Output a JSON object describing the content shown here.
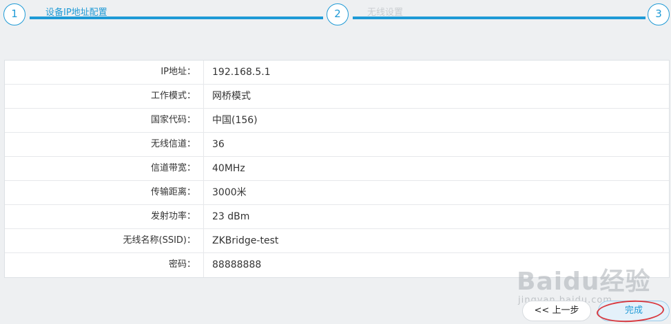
{
  "wizard": {
    "steps": [
      {
        "number": "1",
        "label": "设备IP地址配置",
        "state": "active"
      },
      {
        "number": "2",
        "label": "无线设置",
        "state": "inactive"
      },
      {
        "number": "3",
        "label": "",
        "state": "inactive"
      }
    ]
  },
  "summary": {
    "rows": [
      {
        "label": "IP地址：",
        "value": "192.168.5.1"
      },
      {
        "label": "工作模式：",
        "value": "网桥模式"
      },
      {
        "label": "国家代码：",
        "value": "中国(156)"
      },
      {
        "label": "无线信道：",
        "value": "36"
      },
      {
        "label": "信道带宽：",
        "value": "40MHz"
      },
      {
        "label": "传输距离：",
        "value": "3000米"
      },
      {
        "label": "发射功率：",
        "value": "23 dBm"
      },
      {
        "label": "无线名称(SSID)：",
        "value": "ZKBridge-test"
      },
      {
        "label": "密码：",
        "value": "88888888"
      }
    ]
  },
  "buttons": {
    "prev_label": "<< 上一步",
    "finish_label": "完成"
  },
  "watermark": {
    "logo_text": "Baidu经验",
    "sub_text": "jingyan.baidu.com"
  },
  "colors": {
    "accent": "#1e9ad6",
    "highlight": "#d9393f",
    "background": "#eef0f2"
  }
}
